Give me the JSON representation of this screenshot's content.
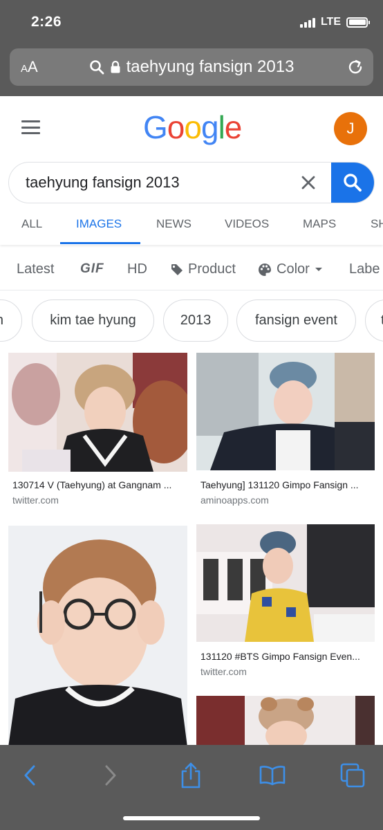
{
  "status_bar": {
    "time": "2:26",
    "network": "LTE"
  },
  "browser": {
    "text_size_label": "AA",
    "url": "taehyung fansign 2013"
  },
  "google": {
    "logo_letters": [
      {
        "ch": "G",
        "color": "#4285F4"
      },
      {
        "ch": "o",
        "color": "#EA4335"
      },
      {
        "ch": "o",
        "color": "#FBBC05"
      },
      {
        "ch": "g",
        "color": "#4285F4"
      },
      {
        "ch": "l",
        "color": "#34A853"
      },
      {
        "ch": "e",
        "color": "#EA4335"
      }
    ],
    "avatar_letter": "J"
  },
  "search": {
    "query": "taehyung fansign 2013"
  },
  "tabs": [
    {
      "label": "ALL",
      "active": false
    },
    {
      "label": "IMAGES",
      "active": true
    },
    {
      "label": "NEWS",
      "active": false
    },
    {
      "label": "VIDEOS",
      "active": false
    },
    {
      "label": "MAPS",
      "active": false
    },
    {
      "label": "SH",
      "active": false
    }
  ],
  "tools": {
    "latest": "Latest",
    "gif": "GIF",
    "hd": "HD",
    "product": "Product",
    "color": "Color",
    "labeled": "Labe"
  },
  "chips": [
    "n",
    "kim tae hyung",
    "2013",
    "fansign event",
    "t"
  ],
  "results": [
    {
      "title": "130714 V (Taehyung) at Gangnam ...",
      "source": "twitter.com"
    },
    {
      "title": "Taehyung] 131120 Gimpo Fansign ...",
      "source": "aminoapps.com"
    },
    {
      "title": "",
      "source": ""
    },
    {
      "title": "131120 #BTS Gimpo Fansign Even...",
      "source": "twitter.com"
    },
    {
      "title": "",
      "source": ""
    }
  ],
  "colors": {
    "accent": "#1a73e8",
    "avatar": "#e8710a",
    "browser_chrome": "#5a5a5a",
    "toolbar_icons": "#3d8fe8"
  }
}
